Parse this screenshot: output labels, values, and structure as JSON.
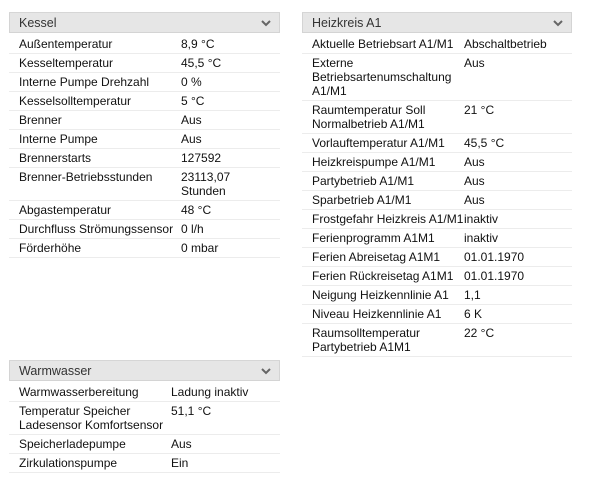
{
  "panels": {
    "kessel": {
      "title": "Kessel",
      "rows": [
        {
          "label": "Außentemperatur",
          "value": "8,9 °C"
        },
        {
          "label": "Kesseltemperatur",
          "value": "45,5 °C"
        },
        {
          "label": "Interne Pumpe Drehzahl",
          "value": "0 %"
        },
        {
          "label": "Kesselsolltemperatur",
          "value": "5 °C"
        },
        {
          "label": "Brenner",
          "value": "Aus"
        },
        {
          "label": "Interne Pumpe",
          "value": "Aus"
        },
        {
          "label": "Brennerstarts",
          "value": "127592"
        },
        {
          "label": "Brenner-Betriebsstunden",
          "value": "23113,07 Stunden"
        },
        {
          "label": "Abgastemperatur",
          "value": "48 °C"
        },
        {
          "label": "Durchfluss Strömungssensor",
          "value": "0 l/h"
        },
        {
          "label": "Förderhöhe",
          "value": "0 mbar"
        }
      ]
    },
    "heizkreis": {
      "title": "Heizkreis A1",
      "rows": [
        {
          "label": "Aktuelle Betriebsart A1/M1",
          "value": "Abschaltbetrieb"
        },
        {
          "label": "Externe Betriebsartenumschaltung A1/M1",
          "value": "Aus"
        },
        {
          "label": "Raumtemperatur Soll Normalbetrieb A1/M1",
          "value": "21 °C"
        },
        {
          "label": "Vorlauftemperatur A1/M1",
          "value": "45,5 °C"
        },
        {
          "label": "Heizkreispumpe A1/M1",
          "value": "Aus"
        },
        {
          "label": "Partybetrieb A1/M1",
          "value": "Aus"
        },
        {
          "label": "Sparbetrieb A1/M1",
          "value": "Aus"
        },
        {
          "label": "Frostgefahr Heizkreis A1/M1",
          "value": "inaktiv"
        },
        {
          "label": "Ferienprogramm A1M1",
          "value": "inaktiv"
        },
        {
          "label": "Ferien Abreisetag A1M1",
          "value": "01.01.1970"
        },
        {
          "label": "Ferien Rückreisetag A1M1",
          "value": "01.01.1970"
        },
        {
          "label": "Neigung Heizkennlinie A1",
          "value": "1,1"
        },
        {
          "label": "Niveau Heizkennlinie A1",
          "value": "6 K"
        },
        {
          "label": "Raumsolltemperatur Partybetrieb A1M1",
          "value": "22 °C"
        }
      ]
    },
    "warmwasser": {
      "title": "Warmwasser",
      "rows": [
        {
          "label": "Warmwasserbereitung",
          "value": "Ladung inaktiv"
        },
        {
          "label": "Temperatur Speicher Ladesensor Komfortsensor",
          "value": "51,1 °C"
        },
        {
          "label": "Speicherladepumpe",
          "value": "Aus"
        },
        {
          "label": "Zirkulationspumpe",
          "value": "Ein"
        }
      ]
    }
  },
  "icons": {
    "collapse": "chevron-down-icon"
  },
  "colors": {
    "header_bg": "#e6e6e6",
    "row_border": "#ececec"
  }
}
